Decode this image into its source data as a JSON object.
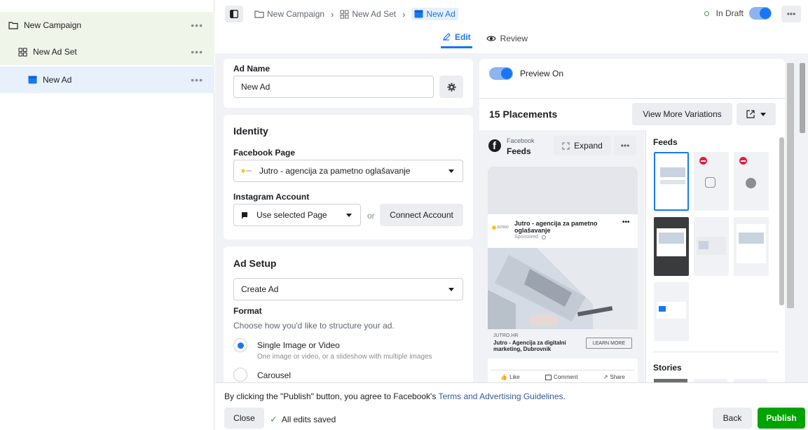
{
  "tree": {
    "campaign": "New Campaign",
    "adset": "New Ad Set",
    "ad": "New Ad",
    "more": "•••"
  },
  "header": {
    "crumbs": [
      "New Campaign",
      "New Ad Set",
      "New Ad"
    ],
    "status": "In Draft",
    "tabs": [
      "Edit",
      "Review"
    ]
  },
  "ad_name": {
    "label": "Ad Name",
    "value": "New Ad"
  },
  "identity": {
    "title": "Identity",
    "fb_page_label": "Facebook Page",
    "fb_page_value": "Jutro - agencija za pametno oglašavanje",
    "ig_label": "Instagram Account",
    "ig_value": "Use selected Page",
    "or": "or",
    "connect": "Connect Account"
  },
  "ad_setup": {
    "title": "Ad Setup",
    "create_value": "Create Ad",
    "format_label": "Format",
    "format_help": "Choose how you'd like to structure your ad.",
    "opt1": "Single Image or Video",
    "opt1_sub": "One image or video, or a slideshow with multiple images",
    "opt2": "Carousel"
  },
  "preview": {
    "toggle_label": "Preview On",
    "placements": "15 Placements",
    "view_more": "View More Variations",
    "platform": "Facebook",
    "placement": "Feeds",
    "expand": "Expand",
    "page_name": "Jutro - agencija za pametno oglašavanje",
    "sponsored": "Sponsored · ",
    "site": "JUTRO.HR",
    "headline": "Jutro - Agencija za digitalni marketing, Dubrovnik",
    "cta": "LEARN MORE",
    "like": "Like",
    "comment": "Comment",
    "share": "Share",
    "logo_text": "JUTRO",
    "feeds_heading": "Feeds",
    "stories_heading": "Stories"
  },
  "footer": {
    "terms_prefix": "By clicking the \"Publish\" button, you agree to Facebook's ",
    "terms_link": "Terms and Advertising Guidelines",
    "terms_suffix": ".",
    "close": "Close",
    "saved": "All edits saved",
    "back": "Back",
    "publish": "Publish"
  },
  "colors": {
    "accent": "#1877f2",
    "publish": "#00a400",
    "draft": "#31a24c"
  }
}
